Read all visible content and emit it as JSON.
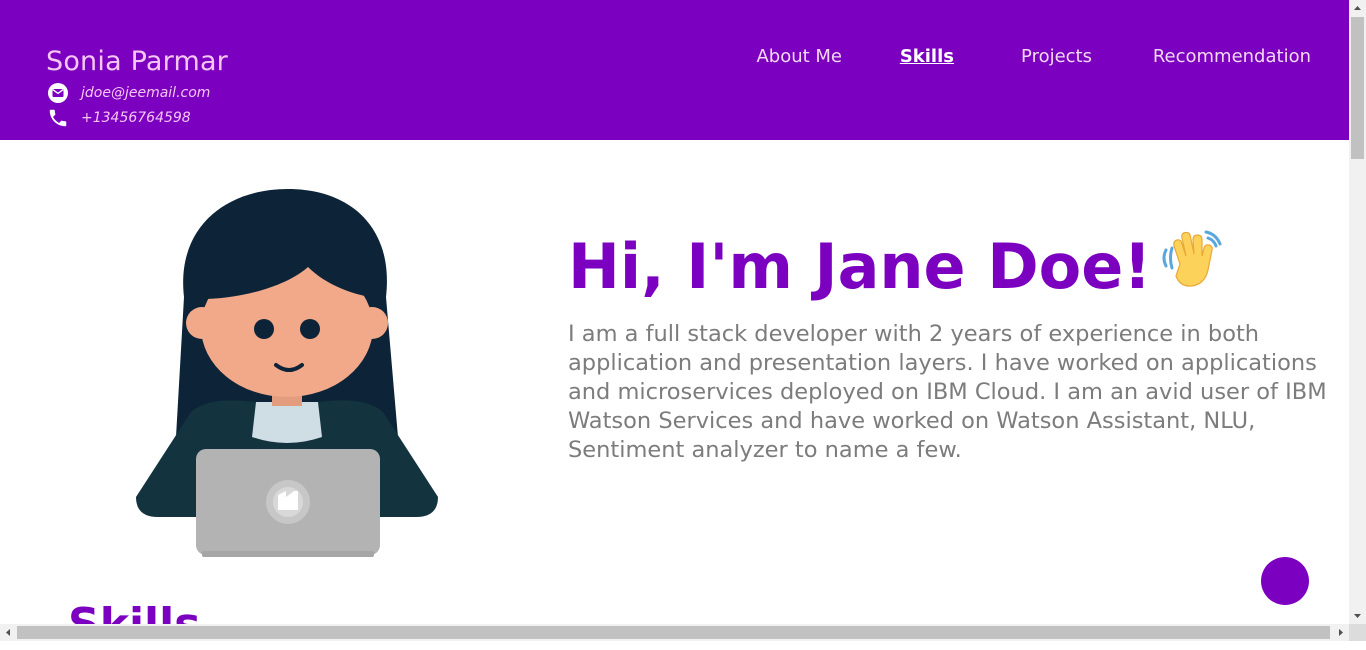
{
  "header": {
    "name": "Sonia Parmar",
    "email": "jdoe@jeemail.com",
    "phone": "+13456764598",
    "email_icon": "mail-icon",
    "phone_icon": "phone-icon",
    "nav": [
      {
        "label": "About Me",
        "active": false
      },
      {
        "label": "Skills",
        "active": true
      },
      {
        "label": "Projects",
        "active": false
      },
      {
        "label": "Recommendation",
        "active": false
      }
    ]
  },
  "hero": {
    "title": "Hi, I'm Jane Doe!",
    "wave_icon": "waving-hand-icon",
    "intro": "I am a full stack developer with 2 years of experience in both application and presentation layers. I have worked on applications and microservices deployed on IBM Cloud. I am an avid user of IBM Watson Services and have worked on Watson Assistant, NLU, Sentiment analyzer to name a few.",
    "illustration": "developer-avatar-illustration"
  },
  "skills_heading": "Skills",
  "colors": {
    "brand": "#7b00c0",
    "header_text": "#f6c6f2",
    "body_text": "#7c7c7c"
  }
}
